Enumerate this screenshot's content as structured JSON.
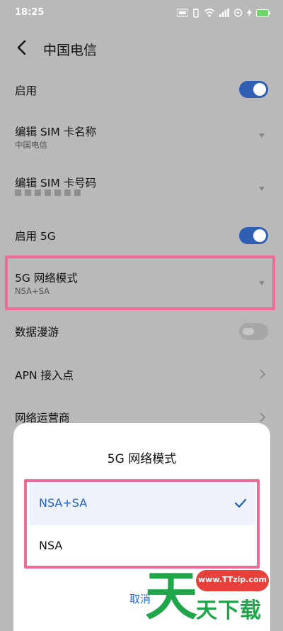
{
  "status_bar": {
    "time": "18:25"
  },
  "header": {
    "title": "中国电信"
  },
  "settings": {
    "enable": {
      "label": "启用",
      "on": true
    },
    "edit_sim_name": {
      "label": "编辑 SIM 卡名称",
      "value": "中国电信"
    },
    "edit_sim_number": {
      "label": "编辑 SIM 卡号码"
    },
    "enable_5g": {
      "label": "启用 5G",
      "on": true
    },
    "network_mode": {
      "label": "5G 网络模式",
      "value": "NSA+SA"
    },
    "data_roaming": {
      "label": "数据漫游",
      "on": false
    },
    "apn": {
      "label": "APN 接入点"
    },
    "carrier": {
      "label": "网络运营商"
    }
  },
  "dialog": {
    "title": "5G 网络模式",
    "options": [
      {
        "label": "NSA+SA",
        "selected": true
      },
      {
        "label": "NSA",
        "selected": false
      }
    ],
    "cancel_label": "取消"
  },
  "watermark": {
    "url": "www.TTzip.com",
    "big_char": "天",
    "text": "天下载"
  },
  "colors": {
    "accent": "#2f5fb3",
    "highlight": "#f06a97",
    "watermark_green": "#1fa64a",
    "watermark_red": "#e8403a"
  }
}
